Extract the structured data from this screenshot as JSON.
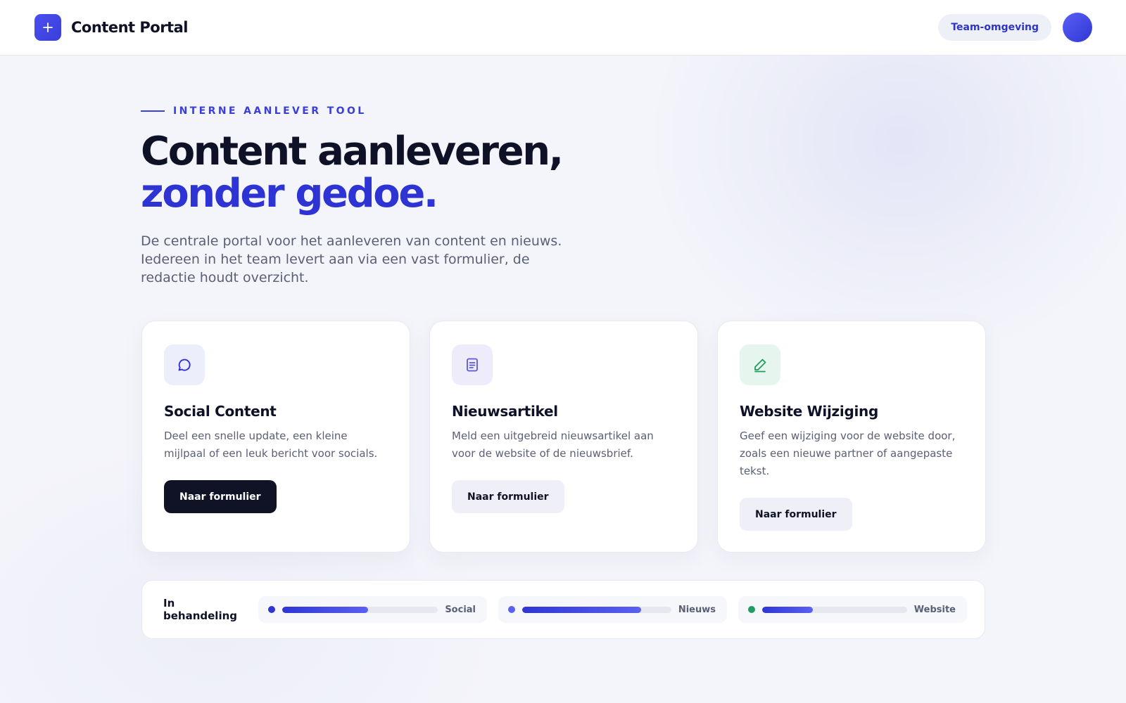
{
  "header": {
    "app_name": "Content Portal",
    "logo_icon": "plus-icon",
    "environment_label": "Team-omgeving"
  },
  "hero": {
    "eyebrow": "INTERNE AANLEVER TOOL",
    "title_line1": "Content aanleveren,",
    "title_line2": "zonder gedoe.",
    "subtitle": "De centrale portal voor het aanleveren van content en nieuws. Iedereen in het team levert aan via een vast formulier, de redactie houdt overzicht."
  },
  "cards": [
    {
      "icon": "chat-bubble-icon",
      "title": "Social Content",
      "description": "Deel een snelle update, een kleine mijlpaal of een leuk bericht voor socials.",
      "button_label": "Naar formulier"
    },
    {
      "icon": "document-icon",
      "title": "Nieuwsartikel",
      "description": "Meld een uitgebreid nieuwsartikel aan voor de website of de nieuwsbrief.",
      "button_label": "Naar formulier"
    },
    {
      "icon": "pencil-icon",
      "title": "Website Wijziging",
      "description": "Geef een wijziging voor de website door, zoals een nieuwe partner of aangepaste tekst.",
      "button_label": "Naar formulier"
    }
  ],
  "status": {
    "label": "In behandeling",
    "items": [
      {
        "name": "Social",
        "progress": 0.55,
        "dot_color": "#3036d4"
      },
      {
        "name": "Nieuws",
        "progress": 0.8,
        "dot_color": "#5b60f0"
      },
      {
        "name": "Website",
        "progress": 0.35,
        "dot_color": "#1f9d63"
      }
    ]
  },
  "colors": {
    "accent": "#2e34d4",
    "dark": "#101326",
    "success": "#1f9d63"
  }
}
